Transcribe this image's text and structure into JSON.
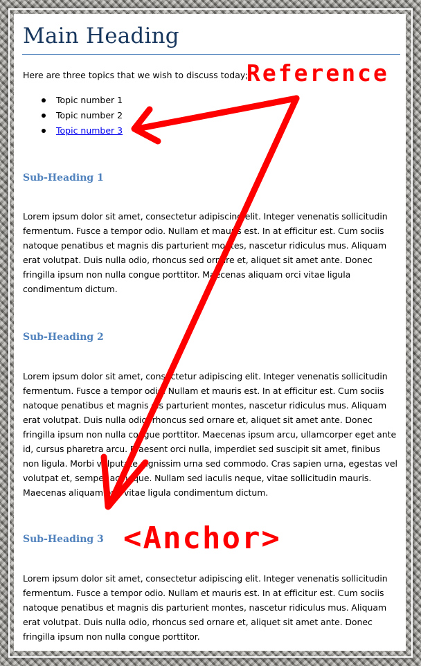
{
  "document": {
    "main_heading": "Main Heading",
    "intro": "Here are three topics that we wish to discuss today;",
    "topics": [
      {
        "label": "Topic number 1",
        "is_link": false
      },
      {
        "label": "Topic number 2",
        "is_link": false
      },
      {
        "label": "Topic number 3",
        "is_link": true
      }
    ],
    "sections": [
      {
        "heading": "Sub-Heading 1",
        "body": "Lorem ipsum dolor sit amet, consectetur adipiscing elit. Integer venenatis sollicitudin fermentum. Fusce a tempor odio. Nullam et mauris est. In at efficitur est. Cum sociis natoque penatibus et magnis dis parturient montes, nascetur ridiculus mus. Aliquam erat volutpat. Duis nulla odio, rhoncus sed ornare et, aliquet sit amet ante. Donec fringilla ipsum non nulla congue porttitor. Maecenas aliquam orci vitae ligula condimentum dictum."
      },
      {
        "heading": "Sub-Heading 2",
        "body": "Lorem ipsum dolor sit amet, consectetur adipiscing elit. Integer venenatis sollicitudin fermentum. Fusce a tempor odio. Nullam et mauris est. In at efficitur est. Cum sociis natoque penatibus et magnis dis parturient montes, nascetur ridiculus mus. Aliquam erat volutpat. Duis nulla odio, rhoncus sed ornare et, aliquet sit amet ante. Donec fringilla ipsum non nulla congue porttitor. Maecenas ipsum arcu, ullamcorper eget ante id, cursus pharetra arcu. Praesent orci nulla, imperdiet sed suscipit sit amet, finibus non ligula. Morbi vulputate dignissim urna sed commodo. Cras sapien urna, egestas vel volutpat et, semper ac neque. Nullam sed iaculis neque, vitae sollicitudin mauris. Maecenas aliquam orci vitae ligula condimentum dictum."
      },
      {
        "heading": "Sub-Heading 3",
        "body": "Lorem ipsum dolor sit amet, consectetur adipiscing elit. Integer venenatis sollicitudin fermentum. Fusce a tempor odio. Nullam et mauris est. In at efficitur est. Cum sociis natoque penatibus et magnis dis parturient montes, nascetur ridiculus mus. Aliquam erat volutpat. Duis nulla odio, rhoncus sed ornare et, aliquet sit amet ante. Donec fringilla ipsum non nulla congue porttitor."
      }
    ]
  },
  "annotations": {
    "reference_label": "Reference",
    "anchor_label": "<Anchor>",
    "color": "#ff0000"
  },
  "colors": {
    "heading": "#17365d",
    "subheading": "#4f81bd",
    "link": "#0000ee"
  }
}
